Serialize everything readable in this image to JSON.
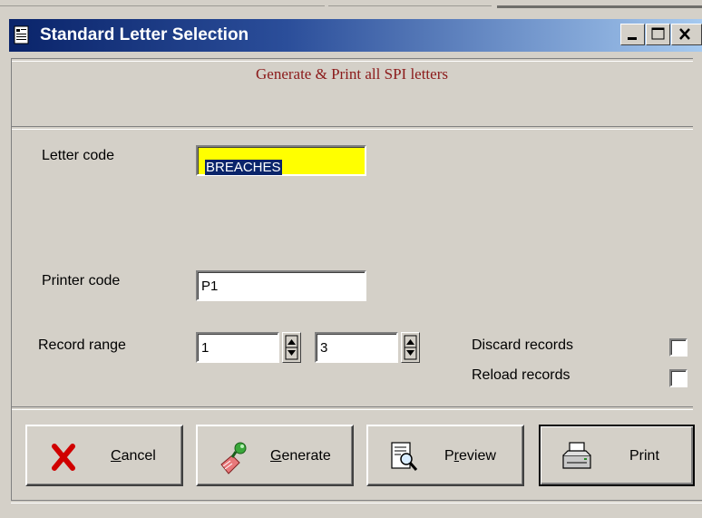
{
  "window": {
    "title": "Standard Letter Selection"
  },
  "heading": "Generate & Print all SPI letters",
  "form": {
    "letter_code": {
      "label": "Letter code",
      "value": "BREACHES"
    },
    "printer_code": {
      "label": "Printer code",
      "value": "P1"
    },
    "record_range": {
      "label": "Record range",
      "from": "1",
      "to": "3"
    },
    "discard_records": {
      "label": "Discard records",
      "checked": false
    },
    "reload_records": {
      "label": "Reload records",
      "checked": false
    }
  },
  "buttons": {
    "cancel": {
      "label_pre": "",
      "mnemonic": "C",
      "label_post": "ancel",
      "icon": "red-x-icon"
    },
    "generate": {
      "label_pre": "",
      "mnemonic": "G",
      "label_post": "enerate",
      "icon": "generate-icon"
    },
    "preview": {
      "label_pre": "P",
      "mnemonic": "r",
      "label_post": "eview",
      "icon": "preview-icon"
    },
    "print": {
      "label": "Print",
      "icon": "printer-icon"
    }
  },
  "colors": {
    "heading": "#8b1a1a",
    "highlight_field": "#ffff00",
    "title_bar": "#0a246a"
  }
}
